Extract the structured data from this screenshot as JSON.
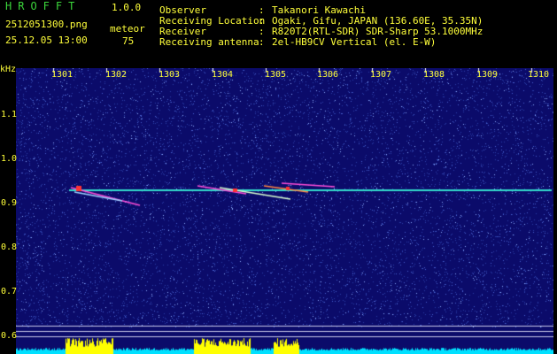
{
  "header": {
    "logo": "HROFFT",
    "version": "1.0.0",
    "filename": "2512051300.png",
    "datetime": "25.12.05 13:00",
    "meteor_label": "meteor",
    "meteor_count": "75",
    "observer_label": "Observer",
    "observer_value": "Takanori Kawachi",
    "location_label": "Receiving Location",
    "location_value": "Ogaki, Gifu, JAPAN (136.60E, 35.35N)",
    "receiver_label": "Receiver",
    "receiver_value": "R820T2(RTL-SDR) SDR-Sharp 53.1000MHz",
    "antenna_label": "Receiving antenna",
    "antenna_value": "2el-HB9CV Vertical (el. E-W)",
    "separator": ":"
  },
  "axes": {
    "y_unit": "kHz",
    "y_ticks": [
      "1.1",
      "1.0",
      "0.9",
      "0.8",
      "0.7",
      "0.6"
    ],
    "x_ticks": [
      "1301",
      "1302",
      "1303",
      "1304",
      "1305",
      "1306",
      "1307",
      "1308",
      "1309",
      "1310"
    ]
  },
  "colors": {
    "background": "#000000",
    "plot_background": "#0b0b6a",
    "label_green": "#3bd63b",
    "label_yellow": "#ffff3a",
    "carrier": "#33ddcc",
    "histogram_yellow": "#ffff00",
    "histogram_cyan": "#00e0ff"
  }
}
